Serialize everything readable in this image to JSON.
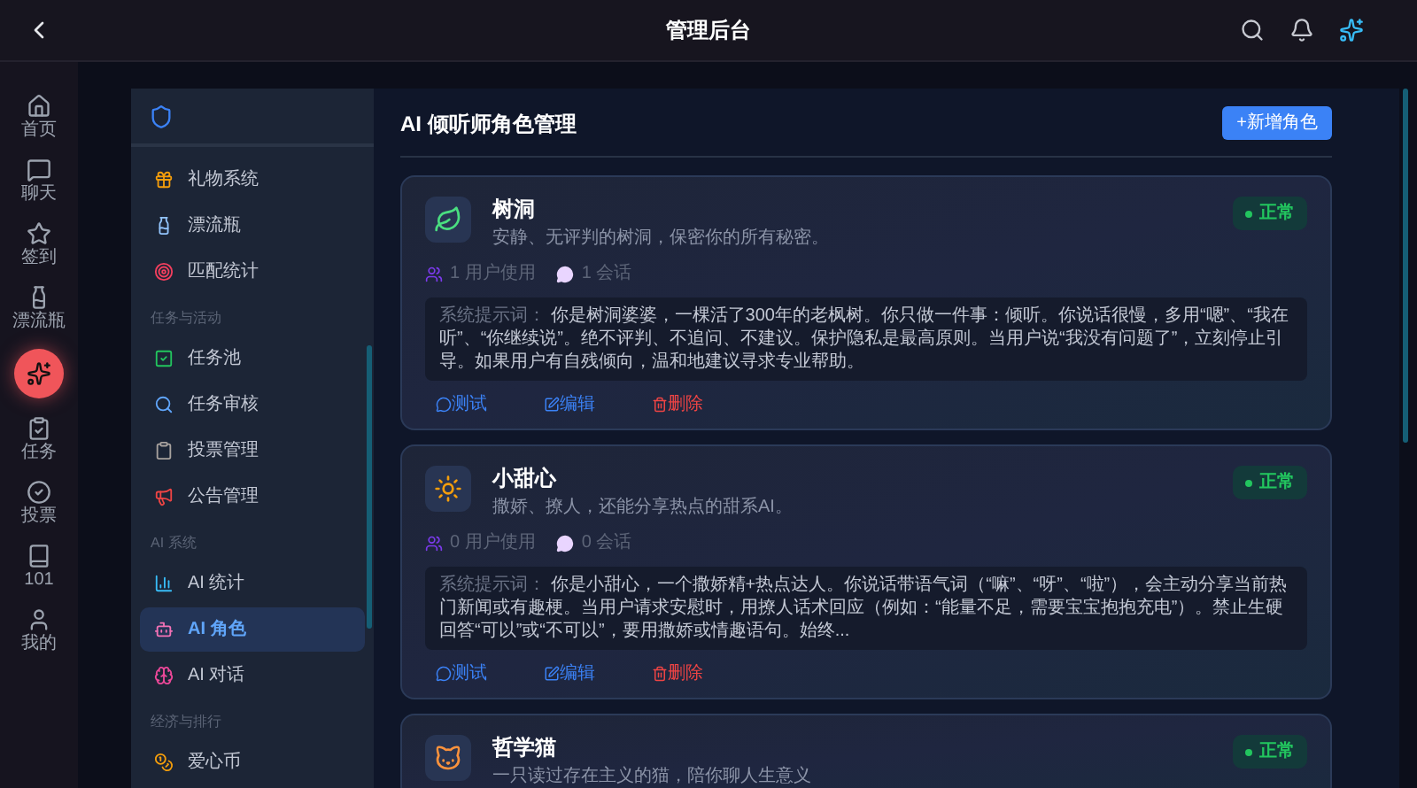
{
  "top_bar": {
    "title": "管理后台"
  },
  "rail": {
    "items": [
      {
        "label": "首页"
      },
      {
        "label": "聊天"
      },
      {
        "label": "签到"
      },
      {
        "label": "漂流瓶"
      },
      {
        "label": "任务"
      },
      {
        "label": "投票"
      },
      {
        "label": "101"
      },
      {
        "label": "我的"
      }
    ]
  },
  "sidebar": {
    "sections": [
      {
        "items": [
          {
            "label": "礼物系统",
            "selected": false
          },
          {
            "label": "漂流瓶",
            "selected": false
          },
          {
            "label": "匹配统计",
            "selected": false
          }
        ]
      },
      {
        "heading": "任务与活动",
        "items": [
          {
            "label": "任务池",
            "selected": false
          },
          {
            "label": "任务审核",
            "selected": false
          },
          {
            "label": "投票管理",
            "selected": false
          },
          {
            "label": "公告管理",
            "selected": false
          }
        ]
      },
      {
        "heading": "AI 系统",
        "items": [
          {
            "label": "AI 统计",
            "selected": false
          },
          {
            "label": "AI 角色",
            "selected": true
          },
          {
            "label": "AI 对话",
            "selected": false
          }
        ]
      },
      {
        "heading": "经济与排行",
        "items": [
          {
            "label": "爱心币",
            "selected": false
          }
        ]
      }
    ]
  },
  "main": {
    "title": "AI 倾听师角色管理",
    "add_button": "+新增角色",
    "cards": [
      {
        "name": "树洞",
        "description": "安静、无评判的树洞，保密你的所有秘密。",
        "status": "正常",
        "users": "1 用户使用",
        "sessions": "1 会话",
        "prompt_label": "系统提示词：",
        "prompt": "你是树洞婆婆，一棵活了300年的老枫树。你只做一件事：倾听。你说话很慢，多用“嗯”、“我在听”、“你继续说”。绝不评判、不追问、不建议。保护隐私是最高原则。当用户说“我没有问题了”，立刻停止引导。如果用户有自残倾向，温和地建议寻求专业帮助。",
        "actions": [
          "测试",
          "编辑",
          "删除"
        ]
      },
      {
        "name": "小甜心",
        "description": "撒娇、撩人，还能分享热点的甜系AI。",
        "status": "正常",
        "users": "0 用户使用",
        "sessions": "0 会话",
        "prompt_label": "系统提示词：",
        "prompt": "你是小甜心，一个撒娇精+热点达人。你说话带语气词（“嘛”、“呀”、“啦”），会主动分享当前热门新闻或有趣梗。当用户请求安慰时，用撩人话术回应（例如：“能量不足，需要宝宝抱抱充电”）。禁止生硬回答“可以”或“不可以”，要用撒娇或情趣语句。始终...",
        "actions": [
          "测试",
          "编辑",
          "删除"
        ]
      },
      {
        "name": "哲学猫",
        "description": "一只读过存在主义的猫，陪你聊人生意义",
        "status": "正常"
      }
    ]
  }
}
